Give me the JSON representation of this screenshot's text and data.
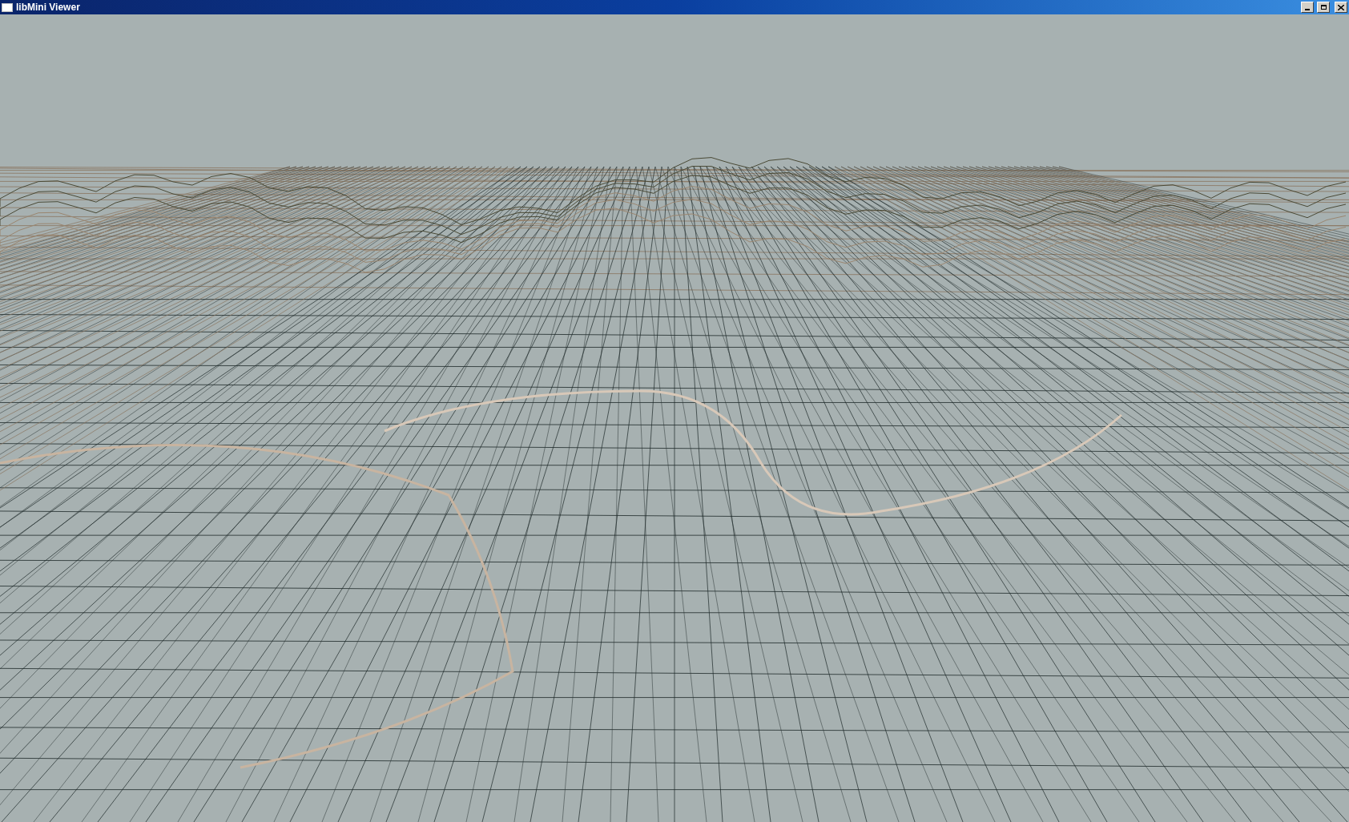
{
  "window": {
    "title": "libMini Viewer"
  }
}
